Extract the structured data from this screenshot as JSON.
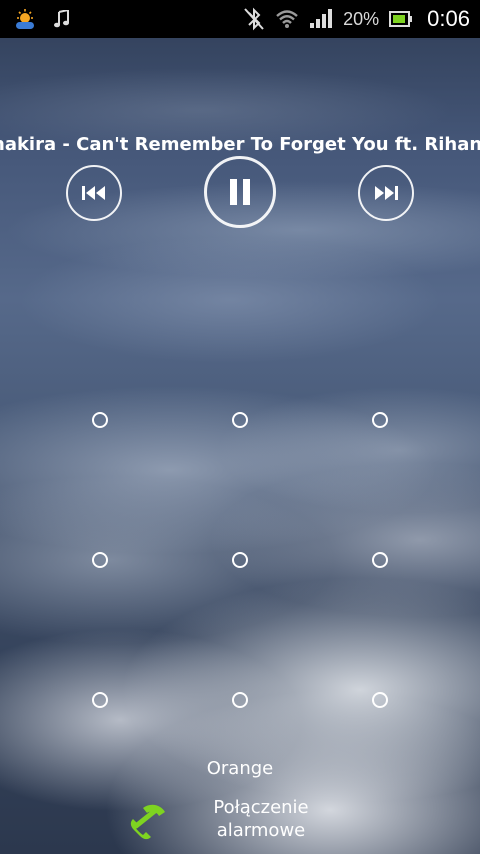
{
  "status_bar": {
    "battery_percent": "20%",
    "time": "0:06",
    "icons": [
      "weather-icon",
      "music-note-icon",
      "bluetooth-icon",
      "wifi-icon",
      "signal-icon",
      "battery-icon"
    ]
  },
  "music": {
    "track_title": "hakira - Can't Remember To Forget You ft. Rihan"
  },
  "controls": {
    "prev_icon": "previous-icon",
    "pause_icon": "pause-icon",
    "next_icon": "next-icon"
  },
  "lock_pattern": {
    "rows": 3,
    "cols": 3
  },
  "carrier": "Orange",
  "emergency": {
    "line1": "Połączenie",
    "line2": "alarmowe"
  },
  "colors": {
    "status_bar_bg": "#000000",
    "phone_icon": "#7ed321"
  }
}
